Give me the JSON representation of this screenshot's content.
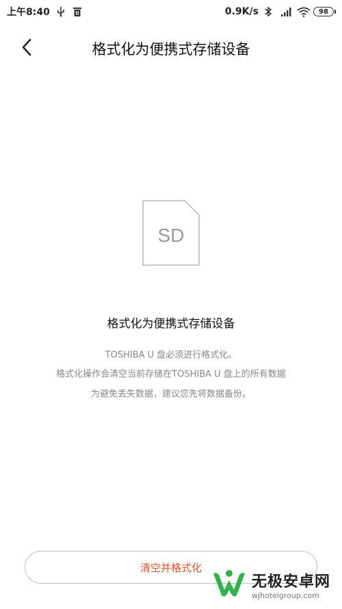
{
  "status_bar": {
    "time": "上午8:40",
    "network_speed": "0.9K/s",
    "battery_level": "98",
    "icons": [
      "usb-icon",
      "trash-icon",
      "bluetooth-icon",
      "signal-icon",
      "wifi-icon",
      "battery-icon"
    ]
  },
  "header": {
    "title": "格式化为便携式存储设备",
    "back_icon": "chevron-left-icon"
  },
  "illustration": {
    "sd_label": "SD"
  },
  "content": {
    "title": "格式化为便携式存储设备",
    "lines": [
      "TOSHIBA U 盘必须进行格式化。",
      "格式化操作会清空当前存储在TOSHIBA U 盘上的所有数据",
      "为避免丢失数据，建议您先将数据备份。"
    ]
  },
  "actions": {
    "format_label": "清空并格式化"
  },
  "watermark": {
    "name": "无极安卓网",
    "url": "wjhotelgroup.com",
    "colors": {
      "green": "#2db34a",
      "dark": "#222222"
    }
  },
  "colors": {
    "accent": "#d9532c",
    "muted_text": "#888888",
    "border": "#bdbdbd"
  }
}
